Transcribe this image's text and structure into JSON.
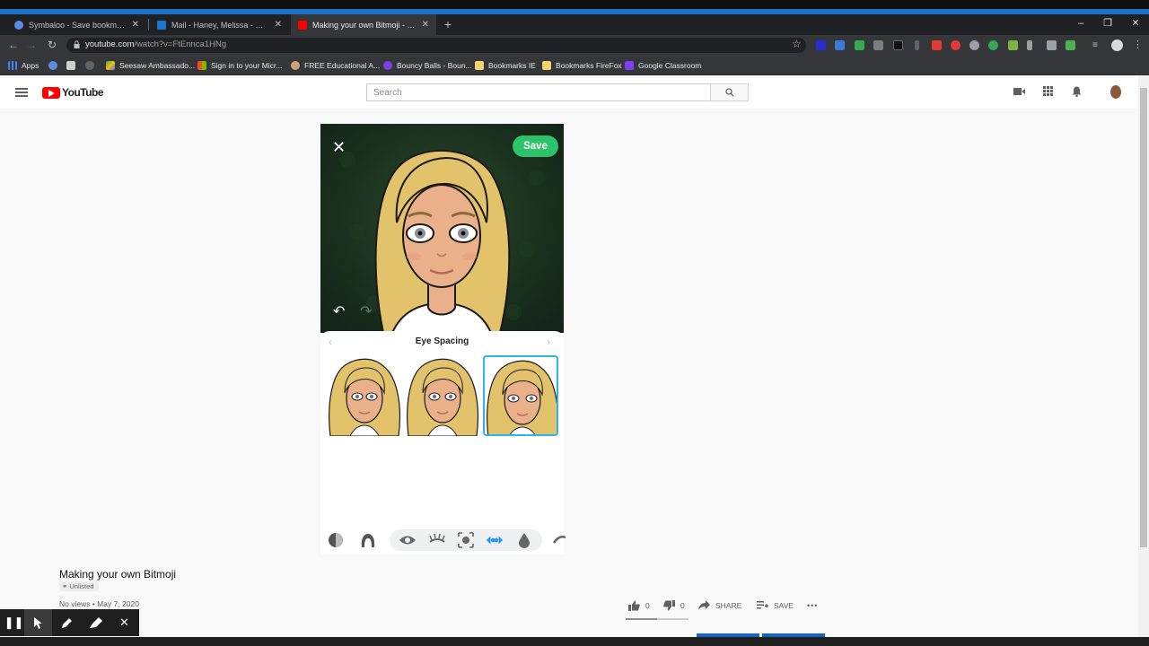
{
  "browser": {
    "tabs": [
      {
        "title": "Symbaloo - Save bookmarks and",
        "favicon_color": "#5c8be0",
        "active": false
      },
      {
        "title": "Mail - Haney, Melissa - Outlook",
        "favicon_color": "#1b74d1",
        "active": false
      },
      {
        "title": "Making your own Bitmoji - YouTu",
        "favicon_color": "#ff0000",
        "active": true
      }
    ],
    "tab_close": "✕",
    "new_tab": "+",
    "window_controls": {
      "minimize": "–",
      "restore": "❐",
      "close": "✕"
    },
    "url_host": "youtube.com",
    "url_path": "/watch?v=FtEnnca1HNg",
    "bookmarks": [
      {
        "label": "Apps",
        "icon_color": "#4285f4"
      },
      {
        "label": "Seesaw Ambassado...",
        "icon_color": "#f4b400"
      },
      {
        "label": "Sign in to your Micr...",
        "icon_color": "#f25022"
      },
      {
        "label": "FREE Educational A...",
        "icon_color": "#c9a27a"
      },
      {
        "label": "Bouncy Balls - Boun...",
        "icon_color": "#7b3fe4"
      },
      {
        "label": "Bookmarks IE",
        "icon_color": "#f6d06a"
      },
      {
        "label": "Bookmarks FireFox",
        "icon_color": "#f6d06a"
      },
      {
        "label": "Google Classroom",
        "icon_color": "#7e3ff2"
      }
    ]
  },
  "youtube": {
    "logo_text": "YouTube",
    "search_placeholder": "Search",
    "video": {
      "save_label": "Save",
      "panel_title": "Eye Spacing",
      "selected_option_index": 2
    },
    "title": "Making your own Bitmoji",
    "badge": "Unlisted",
    "meta": "No views • May 7, 2020",
    "likes": "0",
    "dislikes": "0",
    "share_label": "SHARE",
    "save_label": "SAVE",
    "more": "•••"
  },
  "colors": {
    "save_green": "#2cc36b",
    "selected_border": "#2bb5e9",
    "youtube_red": "#ff0000",
    "hair": "#e3c26c",
    "skin": "#eab08a"
  }
}
